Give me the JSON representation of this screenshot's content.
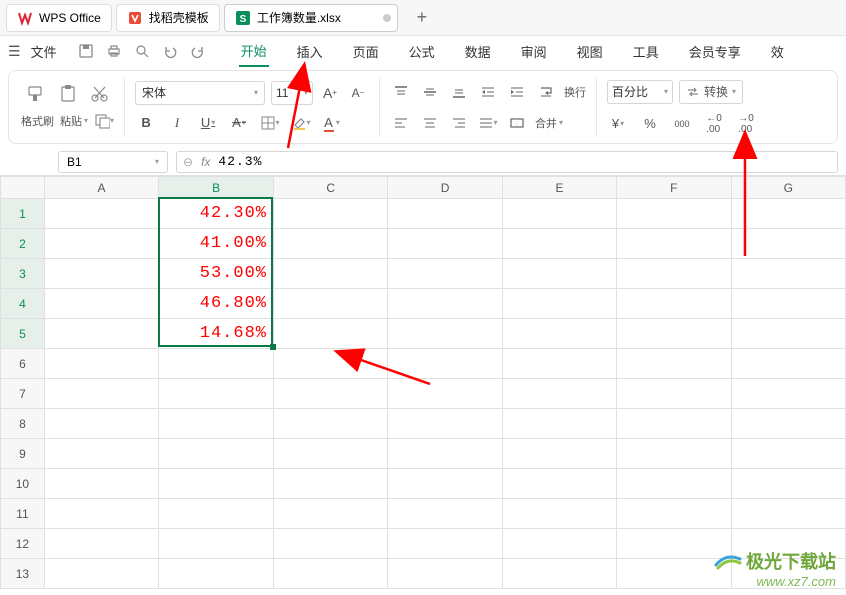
{
  "titlebar": {
    "app_name": "WPS Office",
    "tab_template": "找稻壳模板",
    "doc_name": "工作簿数量.xlsx",
    "add": "+"
  },
  "menubar": {
    "file": "文件",
    "items": [
      "开始",
      "插入",
      "页面",
      "公式",
      "数据",
      "审阅",
      "视图",
      "工具",
      "会员专享",
      "效"
    ]
  },
  "ribbon": {
    "format_painter": "格式刷",
    "paste": "粘贴",
    "font": "宋体",
    "font_size": "11",
    "wrap": "换行",
    "merge": "合并",
    "numfmt": "百分比",
    "convert": "转换"
  },
  "formula_bar": {
    "name": "B1",
    "fx": "fx",
    "value": "42.3%"
  },
  "grid": {
    "cols": [
      "A",
      "B",
      "C",
      "D",
      "E",
      "F",
      "G"
    ],
    "rows": [
      "1",
      "2",
      "3",
      "4",
      "5",
      "6",
      "7",
      "8",
      "9",
      "10",
      "11",
      "12",
      "13"
    ],
    "data_b": [
      "42.30%",
      "41.00%",
      "53.00%",
      "46.80%",
      "14.68%"
    ],
    "selected_col": "B",
    "selected_rows": [
      1,
      2,
      3,
      4,
      5
    ]
  },
  "watermark": {
    "line1": "极光下载站",
    "line2": "www.xz7.com"
  },
  "chart_data": {
    "type": "table",
    "title": "",
    "series": [
      {
        "name": "B",
        "values": [
          42.3,
          41.0,
          53.0,
          46.8,
          14.68
        ],
        "format": "0.00%"
      }
    ]
  }
}
